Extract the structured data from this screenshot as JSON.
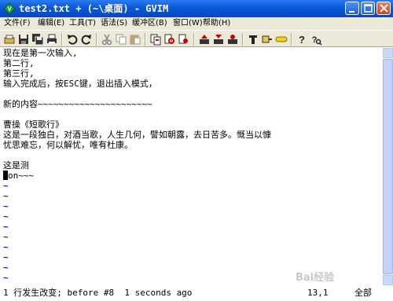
{
  "window": {
    "title": "test2.txt + (~\\桌面) - GVIM",
    "buttons": {
      "minimize_icon": "minimize-icon",
      "maximize_icon": "maximize-icon",
      "close_icon": "close-icon"
    }
  },
  "menu": [
    {
      "label": "文件(F)"
    },
    {
      "label": "编辑(E)"
    },
    {
      "label": "工具(T)"
    },
    {
      "label": "语法(S)"
    },
    {
      "label": "缓冲区(B)"
    },
    {
      "label": "窗口(W)"
    },
    {
      "label": "帮助(H)"
    }
  ],
  "toolbar": [
    "open-icon",
    "save-icon",
    "save-all-icon",
    "print-icon",
    "undo-icon",
    "redo-icon",
    "cut-icon",
    "copy-icon",
    "paste-icon",
    "replace-icon",
    "find-next-icon",
    "find-prev-icon",
    "load-session-icon",
    "save-session-icon",
    "run-script-icon",
    "make-icon",
    "build-tags-icon",
    "jump-tag-icon",
    "help-icon",
    "find-help-icon"
  ],
  "buffer": {
    "lines": [
      "现在是第一次输入,",
      "第二行,",
      "第三行,",
      "输入完成后，按ESC键，退出插入模式，",
      "",
      "新的内容~~~~~~~~~~~~~~~~~~~~~~",
      "",
      "曹操《短歌行》",
      "这是一段独白，对酒当歌，人生几何，譬如朝露，去日苦多。慨当以慷",
      "忧思难忘，何以解忧，唯有杜康。",
      "",
      "这是测"
    ],
    "cursor_line_prefix": "",
    "cursor_line_rest": "on~~~",
    "tilde": "~"
  },
  "status": {
    "message": "1 行发生改变; before #8  1 seconds ago",
    "position": "13,1",
    "percent": "全部"
  },
  "watermark": "Bai经验"
}
